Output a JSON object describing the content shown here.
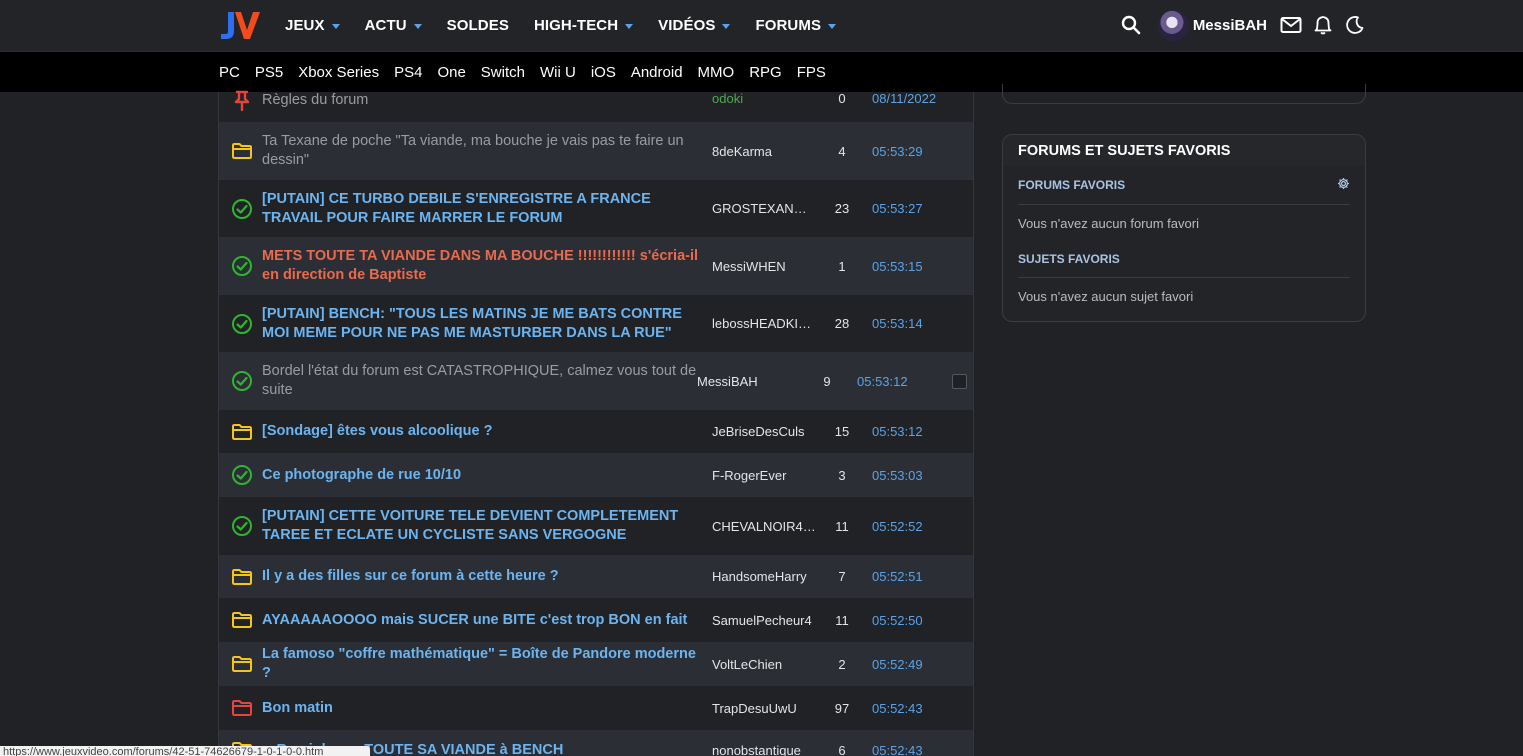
{
  "header": {
    "logo_text": "JV",
    "nav": [
      {
        "label": "JEUX",
        "dropdown": true
      },
      {
        "label": "ACTU",
        "dropdown": true
      },
      {
        "label": "SOLDES",
        "dropdown": false
      },
      {
        "label": "HIGH-TECH",
        "dropdown": true
      },
      {
        "label": "VIDÉOS",
        "dropdown": true
      },
      {
        "label": "FORUMS",
        "dropdown": true
      }
    ],
    "username": "MessiBAH"
  },
  "subnav": [
    "PC",
    "PS5",
    "Xbox Series",
    "PS4",
    "One",
    "Switch",
    "Wii U",
    "iOS",
    "Android",
    "MMO",
    "RPG",
    "FPS"
  ],
  "topics": [
    {
      "icon": "pin",
      "title": "Règles du forum",
      "style": "grey",
      "author": "odoki",
      "author_style": "green",
      "replies": "0",
      "date": "08/11/2022"
    },
    {
      "icon": "folder-yellow",
      "title": "Ta Texane de poche \"Ta viande, ma bouche je vais pas te faire un dessin\"",
      "style": "grey",
      "author": "8deKarma",
      "replies": "4",
      "date": "05:53:29"
    },
    {
      "icon": "check",
      "title": "[PUTAIN] CE TURBO DEBILE S'ENREGISTRE A FRANCE TRAVAIL POUR FAIRE MARRER LE FORUM",
      "style": "blue",
      "author": "GROSTEXANDE…",
      "replies": "23",
      "date": "05:53:27"
    },
    {
      "icon": "check",
      "title": "METS TOUTE TA VIANDE DANS MA BOUCHE !!!!!!!!!!!! s'écria-il en direction de Baptiste",
      "style": "red",
      "author": "MessiWHEN",
      "replies": "1",
      "date": "05:53:15"
    },
    {
      "icon": "check",
      "title": "[PUTAIN] BENCH: \"TOUS LES MATINS JE ME BATS CONTRE MOI MEME POUR NE PAS ME MASTURBER DANS LA RUE\"",
      "style": "blue",
      "author": "lebossHEADKI…",
      "replies": "28",
      "date": "05:53:14"
    },
    {
      "icon": "check",
      "title": "Bordel l'état du forum est CATASTROPHIQUE, calmez vous tout de suite",
      "style": "grey",
      "author": "MessiBAH",
      "replies": "9",
      "date": "05:53:12",
      "hover": true
    },
    {
      "icon": "folder-yellow",
      "title": "[Sondage] êtes vous alcoolique ?",
      "style": "blue",
      "author": "JeBriseDesCuls",
      "replies": "15",
      "date": "05:53:12"
    },
    {
      "icon": "check",
      "title": "Ce photographe de rue 10/10",
      "style": "blue",
      "author": "F-RogerEver",
      "replies": "3",
      "date": "05:53:03"
    },
    {
      "icon": "check",
      "title": "[PUTAIN] CETTE VOITURE TELE DEVIENT COMPLETEMENT TAREE ET ECLATE UN CYCLISTE SANS VERGOGNE",
      "style": "blue",
      "author": "CHEVALNOIR4…",
      "replies": "11",
      "date": "05:52:52"
    },
    {
      "icon": "folder-yellow",
      "title": "Il y a des filles sur ce forum à cette heure ?",
      "style": "blue",
      "author": "HandsomeHarry",
      "replies": "7",
      "date": "05:52:51"
    },
    {
      "icon": "folder-yellow",
      "title": "AYAAAAAOOOO mais SUCER une BITE c'est trop BON en fait",
      "style": "blue",
      "author": "SamuelPecheur4",
      "replies": "11",
      "date": "05:52:50"
    },
    {
      "icon": "folder-yellow",
      "title": "La famoso \"coffre mathématique\" = Boîte de Pandore moderne ?",
      "style": "blue",
      "author": "VoltLeChien",
      "replies": "2",
      "date": "05:52:49"
    },
    {
      "icon": "folder-red",
      "title": "Bon matin",
      "style": "blue",
      "author": "TrapDesuUwU",
      "replies": "97",
      "date": "05:52:43"
    },
    {
      "icon": "folder-yellow",
      "title": "…R qui donne TOUTE SA VIANDE à BENCH",
      "style": "blue",
      "author": "nonobstantique",
      "replies": "6",
      "date": "05:52:43"
    }
  ],
  "sidebar": {
    "panel_title": "FORUMS ET SUJETS FAVORIS",
    "forums_title": "FORUMS FAVORIS",
    "forums_empty": "Vous n'avez aucun forum favori",
    "topics_title": "SUJETS FAVORIS",
    "topics_empty": "Vous n'avez aucun sujet favori"
  },
  "statusbar": {
    "url": "https://www.jeuxvideo.com/forums/42-51-74626679-1-0-1-0-0.htm"
  },
  "colors": {
    "link_blue": "#6cb4f0",
    "hot_red": "#e96a4d",
    "check_green": "#2fb52f",
    "folder_yellow": "#f5c518",
    "folder_red": "#e8443a"
  }
}
